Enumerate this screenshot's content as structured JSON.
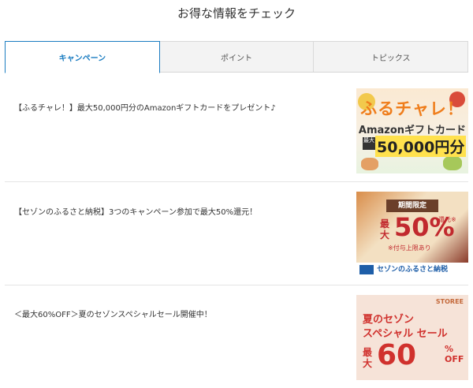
{
  "header": {
    "title": "お得な情報をチェック"
  },
  "tabs": [
    {
      "label": "キャンペーン",
      "active": true
    },
    {
      "label": "ポイント",
      "active": false
    },
    {
      "label": "トピックス",
      "active": false
    }
  ],
  "items": [
    {
      "text": "【ふるチャレ！】最大50,000円分のAmazonギフトカードをプレゼント♪",
      "banner": {
        "headline": "ふるチャレ！",
        "subline": "Amazonギフトカード",
        "badge": "最大",
        "amount": "50,000円分"
      }
    },
    {
      "text": "【セゾンのふるさと納税】3つのキャンペーン参加で最大50%還元！",
      "banner": {
        "tag": "期間限定",
        "max": "最大",
        "percent": "50%",
        "suffix": "還元※",
        "note": "※付与上限あり",
        "footer": "セゾンのふるさと納税"
      }
    },
    {
      "text": "＜最大60%OFF＞夏のセゾンスペシャルセール開催中！",
      "banner": {
        "store": "STOREE",
        "line1": "夏のセゾン",
        "line2": "スペシャル セール",
        "max": "最大",
        "percent": "60",
        "off": "% OFF"
      }
    }
  ],
  "colors": {
    "accent": "#1a7cc1",
    "promo_red": "#c1292e",
    "promo_orange": "#ef7d1b"
  }
}
